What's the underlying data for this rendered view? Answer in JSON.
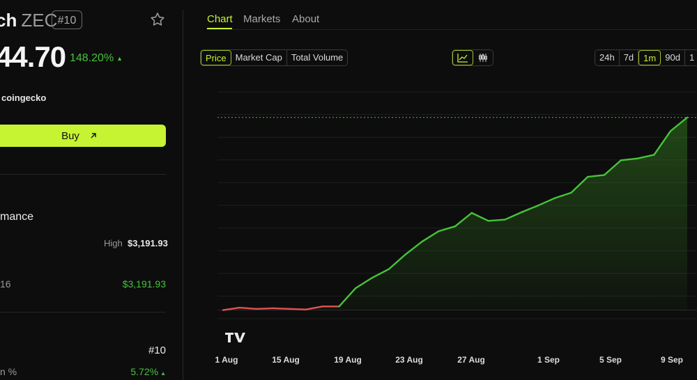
{
  "coin": {
    "name_tail": "ch",
    "symbol": "ZEC",
    "rank_badge": "#10",
    "price": "44.70",
    "change": "148.20%",
    "source": "coingecko",
    "buy_label": "Buy"
  },
  "sidebar": {
    "performance_heading": "mance",
    "high_label": "High",
    "high_value": "$3,191.93",
    "row_label": "16",
    "row_value": "$3,191.93",
    "rank_value": "#10",
    "dominance_label": "n %",
    "dominance_value": "5.72%"
  },
  "tabs": [
    "Chart",
    "Markets",
    "About"
  ],
  "metric_toggle": [
    "Price",
    "Market Cap",
    "Total Volume"
  ],
  "metric_selected": "Price",
  "chart_style_icons": [
    "line-chart-icon",
    "candlestick-icon"
  ],
  "ranges": [
    "24h",
    "7d",
    "1m",
    "90d",
    "1"
  ],
  "range_selected": "1m",
  "colors": {
    "accent": "#c6f432",
    "up": "#46c43a",
    "down": "#e05252",
    "background": "#0d0d0d"
  },
  "chart_data": {
    "type": "line",
    "x_tick_labels": [
      "1 Aug",
      "15 Aug",
      "19 Aug",
      "23 Aug",
      "27 Aug",
      "1 Sep",
      "5 Sep",
      "9 Sep"
    ],
    "values": [
      0.5,
      0.9,
      0.7,
      0.8,
      0.7,
      0.6,
      1.1,
      1.1,
      4.1,
      5.8,
      7.2,
      9.6,
      11.7,
      13.4,
      14.2,
      16.4,
      15.1,
      15.3,
      16.5,
      17.6,
      18.8,
      19.7,
      22.3,
      22.6,
      25.0,
      25.3,
      25.9,
      29.8,
      32.0
    ],
    "baseline_index": 0,
    "watermark": "TV",
    "grid": true
  }
}
